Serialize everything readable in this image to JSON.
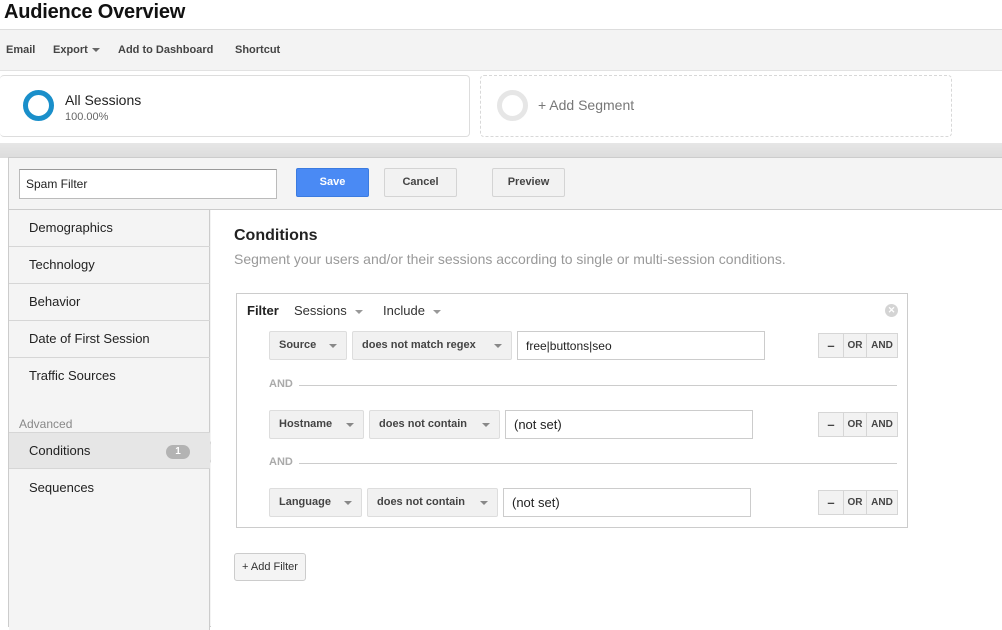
{
  "page": {
    "title": "Audience Overview"
  },
  "toolbar": {
    "email": "Email",
    "export": "Export",
    "add_to_dashboard": "Add to Dashboard",
    "shortcut": "Shortcut"
  },
  "segments": {
    "active": {
      "name": "All Sessions",
      "percent": "100.00%",
      "color": "#1a8fca"
    },
    "add_label": "+ Add Segment"
  },
  "editor": {
    "segment_name_value": "Spam Filter",
    "save": "Save",
    "cancel": "Cancel",
    "preview": "Preview",
    "accent_color": "#4a8af4"
  },
  "sidebar": {
    "items": [
      {
        "label": "Demographics"
      },
      {
        "label": "Technology"
      },
      {
        "label": "Behavior"
      },
      {
        "label": "Date of First Session"
      },
      {
        "label": "Traffic Sources"
      }
    ],
    "section_label": "Advanced",
    "advanced_items": [
      {
        "label": "Conditions",
        "badge": "1",
        "active": true
      },
      {
        "label": "Sequences"
      }
    ]
  },
  "conditions": {
    "title": "Conditions",
    "subtitle": "Segment your users and/or their sessions according to single or multi-session conditions.",
    "filter": {
      "label": "Filter",
      "scope": "Sessions",
      "mode": "Include",
      "rows": [
        {
          "dimension": "Source",
          "operator": "does not match regex",
          "value": "free|buttons|seo"
        },
        {
          "dimension": "Hostname",
          "operator": "does not contain",
          "value": "(not set)"
        },
        {
          "dimension": "Language",
          "operator": "does not contain",
          "value": "(not set)"
        }
      ],
      "joiner": "AND",
      "row_buttons": {
        "remove": "–",
        "or": "OR",
        "and": "AND"
      }
    },
    "add_filter": "+ Add Filter"
  }
}
